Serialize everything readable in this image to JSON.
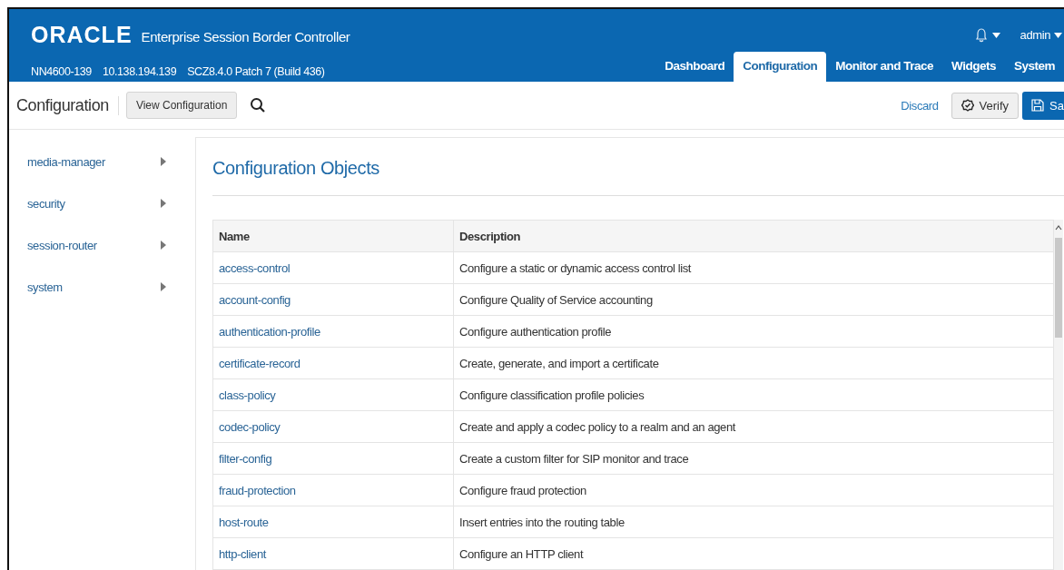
{
  "header": {
    "logo": "ORACLE",
    "product": "Enterprise Session Border Controller",
    "device": "NN4600-139",
    "ip": "10.138.194.139",
    "version": "SCZ8.4.0 Patch 7 (Build 436)",
    "user": "admin"
  },
  "nav_tabs": [
    {
      "label": "Dashboard",
      "selected": false
    },
    {
      "label": "Configuration",
      "selected": true
    },
    {
      "label": "Monitor and Trace",
      "selected": false
    },
    {
      "label": "Widgets",
      "selected": false
    },
    {
      "label": "System",
      "selected": false
    }
  ],
  "toolbar": {
    "title": "Configuration",
    "view_button": "View Configuration",
    "discard": "Discard",
    "verify": "Verify",
    "save": "Sa"
  },
  "sidebar": {
    "items": [
      {
        "label": "media-manager",
        "expanded": false
      },
      {
        "label": "security",
        "expanded": false
      },
      {
        "label": "session-router",
        "expanded": false
      },
      {
        "label": "system",
        "expanded": false
      }
    ]
  },
  "content": {
    "title": "Configuration Objects"
  },
  "table": {
    "columns": [
      "Name",
      "Description"
    ],
    "rows": [
      {
        "name": "access-control",
        "description": "Configure a static or dynamic access control list"
      },
      {
        "name": "account-config",
        "description": "Configure Quality of Service accounting"
      },
      {
        "name": "authentication-profile",
        "description": "Configure authentication profile"
      },
      {
        "name": "certificate-record",
        "description": "Create, generate, and import a certificate"
      },
      {
        "name": "class-policy",
        "description": "Configure classification profile policies"
      },
      {
        "name": "codec-policy",
        "description": "Create and apply a codec policy to a realm and an agent"
      },
      {
        "name": "filter-config",
        "description": "Create a custom filter for SIP monitor and trace"
      },
      {
        "name": "fraud-protection",
        "description": "Configure fraud protection"
      },
      {
        "name": "host-route",
        "description": "Insert entries into the routing table"
      },
      {
        "name": "http-client",
        "description": "Configure an HTTP client"
      }
    ]
  }
}
